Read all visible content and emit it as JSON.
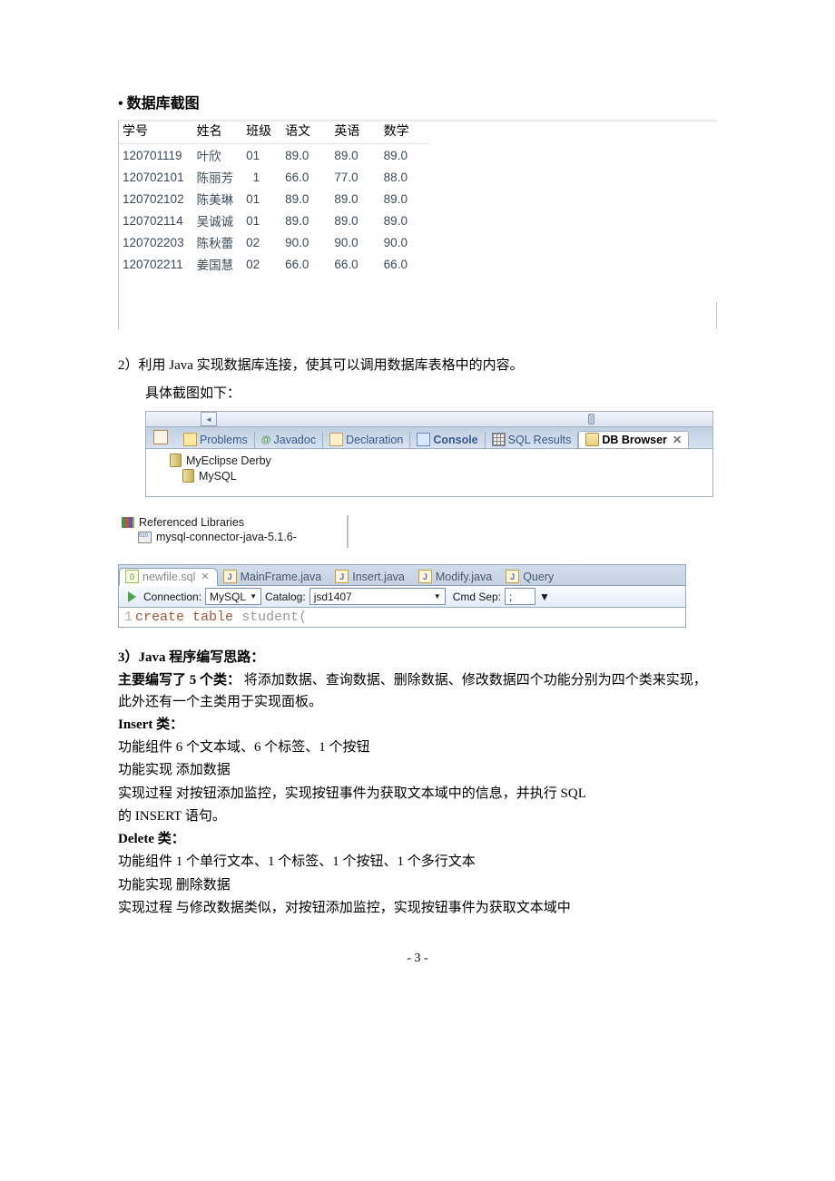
{
  "headings": {
    "db_screenshot": "• 数据库截图",
    "section2": "2）利用 Java 实现数据库连接，使其可以调用数据库表格中的内容。",
    "screenshot_below": "具体截图如下：",
    "section3_title": "3）Java 程序编写思路：",
    "section3_lead_b": "主要编写了 5 个类：",
    "section3_lead": " 将添加数据、查询数据、删除数据、修改数据四个功能分别为四个类来实现，此外还有一个主类用于实现面板。",
    "insert_title": "Insert 类：",
    "delete_title": "Delete 类："
  },
  "db_table": {
    "headers": [
      "学号",
      "姓名",
      "班级",
      "语文",
      "英语",
      "数学"
    ],
    "rows": [
      [
        "120701119",
        "叶欣",
        "01",
        "89.0",
        "89.0",
        "89.0"
      ],
      [
        "120702101",
        "陈丽芳",
        "1",
        "66.0",
        "77.0",
        "88.0"
      ],
      [
        "120702102",
        "陈美琳",
        "01",
        "89.0",
        "89.0",
        "89.0"
      ],
      [
        "120702114",
        "吴诚诚",
        "01",
        "89.0",
        "89.0",
        "89.0"
      ],
      [
        "120702203",
        "陈秋蕾",
        "02",
        "90.0",
        "90.0",
        "90.0"
      ],
      [
        "120702211",
        "姜国慧",
        "02",
        "66.0",
        "66.0",
        "66.0"
      ]
    ]
  },
  "eclipse_tabs": {
    "problems": "Problems",
    "javadoc": "Javadoc",
    "declaration": "Declaration",
    "console": "Console",
    "sql_results": "SQL Results",
    "db_browser": "DB Browser"
  },
  "db_tree": {
    "item1": "MyEclipse Derby",
    "item2": "MySQL"
  },
  "libs": {
    "title": "Referenced Libraries",
    "jar": "mysql-connector-java-5.1.6-"
  },
  "file_tabs": {
    "t1": "newfile.sql",
    "t2": "MainFrame.java",
    "t3": "Insert.java",
    "t4": "Modify.java",
    "t5": "Query"
  },
  "toolbar": {
    "conn_label": "Connection:",
    "conn_value": "MySQL",
    "cat_label": "Catalog:",
    "cat_value": "jsd1407",
    "cmd_label": "Cmd Sep:",
    "cmd_value": ";"
  },
  "editor": {
    "line_no": "1",
    "kw1": "create",
    "kw2": "table",
    "rest": " student("
  },
  "insert_class": {
    "l1a": "功能组件",
    "l1b": "  6 个文本域、6 个标签、1 个按钮",
    "l2a": "功能实现",
    "l2b": "  添加数据",
    "l3a": "实现过程",
    "l3b": "  对按钮添加监控，实现按钮事件为获取文本域中的信息，并执行 SQL",
    "l4": "的 INSERT 语句。"
  },
  "delete_class": {
    "l1a": "功能组件",
    "l1b": "  1 个单行文本、1 个标签、1 个按钮、1 个多行文本",
    "l2a": "功能实现",
    "l2b": "  删除数据",
    "l3a": "实现过程",
    "l3b": "  与修改数据类似，对按钮添加监控，实现按钮事件为获取文本域中"
  },
  "page_number": "- 3 -"
}
